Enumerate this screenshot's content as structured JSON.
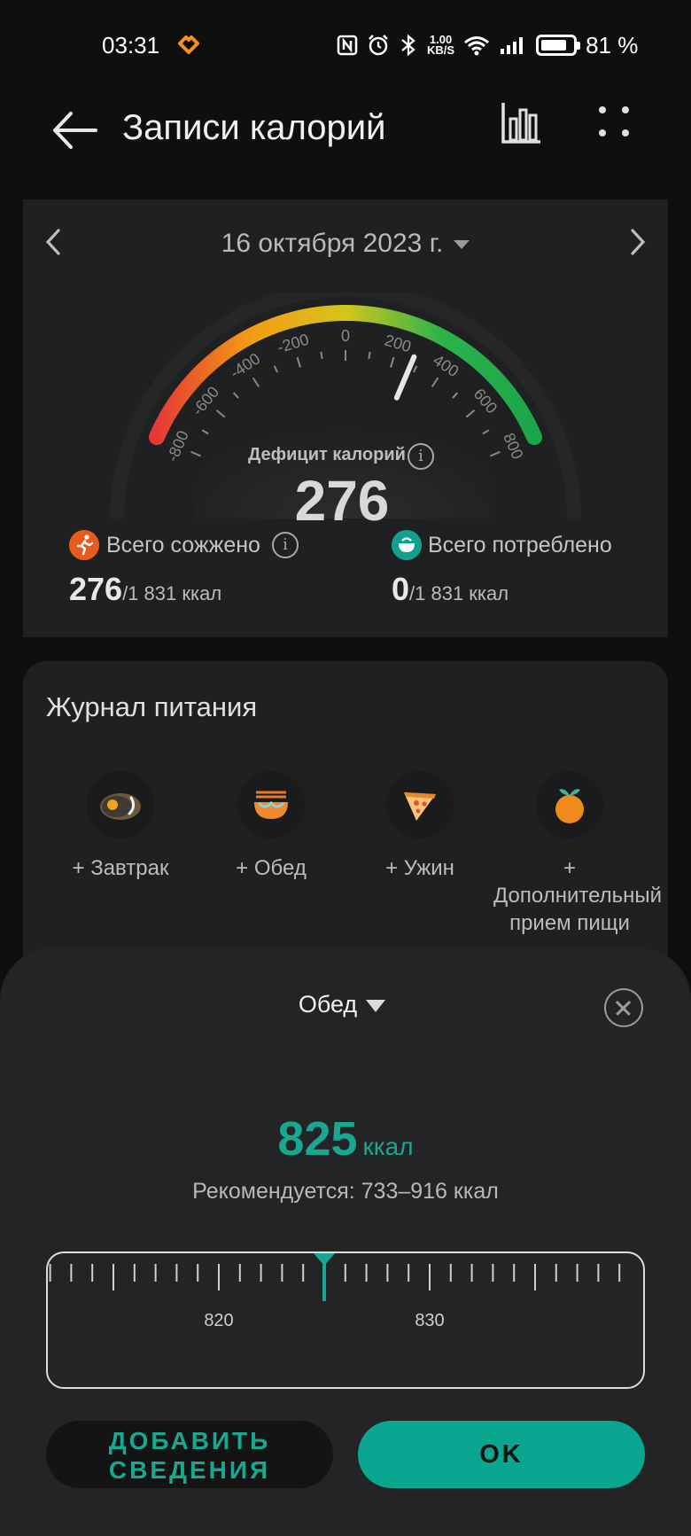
{
  "status_bar": {
    "time": "03:31",
    "net_speed_value": "1.00",
    "net_speed_unit": "KB/S",
    "battery_level": 0.81,
    "battery_percent": "81 %",
    "icons": [
      "health-icon",
      "nfc-icon",
      "alarm-icon",
      "bluetooth-icon",
      "wifi-icon",
      "signal-icon",
      "battery-icon"
    ]
  },
  "header": {
    "title": "Записи калорий",
    "icons": [
      "back-arrow-icon",
      "bar-chart-icon",
      "more-dots-icon"
    ]
  },
  "summary": {
    "date": "16 октября 2023 г.",
    "gauge": {
      "ticks": [
        "-800",
        "-600",
        "-400",
        "-200",
        "0",
        "200",
        "400",
        "600",
        "800"
      ],
      "min": -900,
      "max": 900,
      "needle_value": 276,
      "colors": [
        "#e53935",
        "#f39c12",
        "#d4c51c",
        "#2eb34a",
        "#1aa64a"
      ]
    },
    "deficit_label": "Дефицит калорий",
    "deficit_value": "276",
    "burned_label": "Всего сожжено",
    "burned_value": "276",
    "burned_total": "/1 831 ккал",
    "consumed_label": "Всего потреблено",
    "consumed_value": "0",
    "consumed_total": "/1 831 ккал",
    "colors": {
      "burn": "#e85b1e",
      "eat": "#12a08e"
    }
  },
  "journal": {
    "title": "Журнал питания",
    "meals": [
      {
        "label": "+ Завтрак",
        "icon": "breakfast-egg-icon"
      },
      {
        "label": "+ Обед",
        "icon": "lunch-bowl-icon"
      },
      {
        "label": "+ Ужин",
        "icon": "dinner-pizza-icon"
      },
      {
        "label": "+ Дополнительный прием пищи",
        "icon": "snack-orange-icon"
      }
    ]
  },
  "sheet": {
    "meal": "Обед",
    "kcal_value": "825",
    "kcal_unit": "ккал",
    "recommendation": "Рекомендуется: 733–916 ккал",
    "ruler_labels": [
      "820",
      "830"
    ],
    "selected_value": 825,
    "add_button": "ДОБАВИТЬ СВЕДЕНИЯ",
    "ok_button": "OK",
    "accent": "#0ba68f"
  }
}
